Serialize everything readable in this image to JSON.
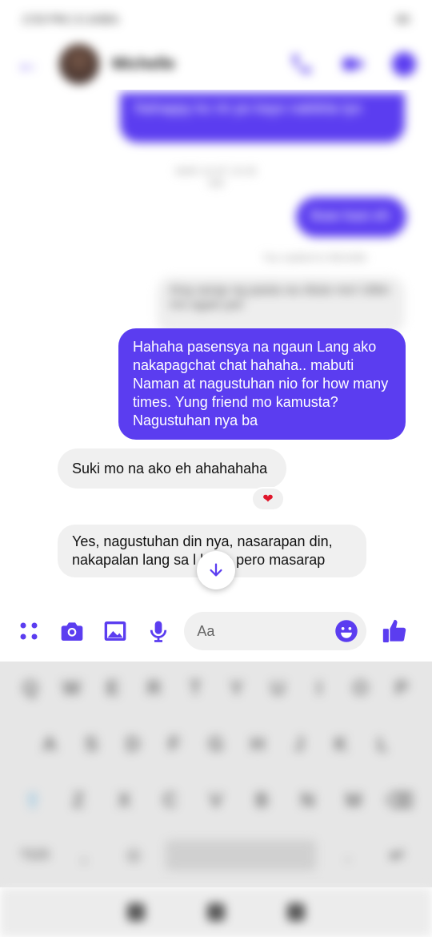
{
  "status_bar": {
    "time": "2:53 PM",
    "speed": "0.1KB/s",
    "battery": "83"
  },
  "header": {
    "contact_name": "Michelle"
  },
  "messages": [
    {
      "id": "m1",
      "direction": "out",
      "text": "Nahappy ko rin po kayo nakikita tyo"
    },
    {
      "id": "ts1",
      "type": "timestamp",
      "text": "MAR 16 AT 10:45 AM"
    },
    {
      "id": "m2",
      "direction": "out",
      "text": "Ikaw kasi eh"
    },
    {
      "id": "seen",
      "type": "status",
      "text": "You replied to Michelle"
    },
    {
      "id": "m2q",
      "type": "reply_preview",
      "text": "Ang sarap ng pasta na niluto mo! Ulitin mo agad yan"
    },
    {
      "id": "m3",
      "direction": "out",
      "text": "Hahaha pasensya na ngaun Lang ako nakapagchat chat hahaha.. mabuti Naman at nagustuhan nio for how many times. Yung friend mo kamusta? Nagustuhan nya ba"
    },
    {
      "id": "m4",
      "direction": "in",
      "text": "Suki mo na ako eh ahahahaha",
      "reaction": "❤"
    },
    {
      "id": "m5",
      "direction": "in",
      "text": "Yes, nagustuhan din nya, nasarapan din, nakapalan lang sa l     hehe pero masarap"
    }
  ],
  "composer": {
    "placeholder": "Aa",
    "icons": [
      "apps-icon",
      "camera-icon",
      "gallery-icon",
      "microphone-icon",
      "emoji-icon",
      "thumbs-up-icon"
    ]
  },
  "keyboard": {
    "row1": [
      "Q",
      "W",
      "E",
      "R",
      "T",
      "Y",
      "U",
      "I",
      "O",
      "P"
    ],
    "row2": [
      "A",
      "S",
      "D",
      "F",
      "G",
      "H",
      "J",
      "K",
      "L"
    ],
    "row3": [
      "⇧",
      "Z",
      "X",
      "C",
      "V",
      "B",
      "N",
      "M",
      "⌫"
    ],
    "row4": [
      "?123",
      ",",
      "☺",
      ".",
      "↵"
    ]
  },
  "colors": {
    "accent": "#5b3df0",
    "bubble_in": "#f0f0f0",
    "reaction": "#e0162b"
  }
}
